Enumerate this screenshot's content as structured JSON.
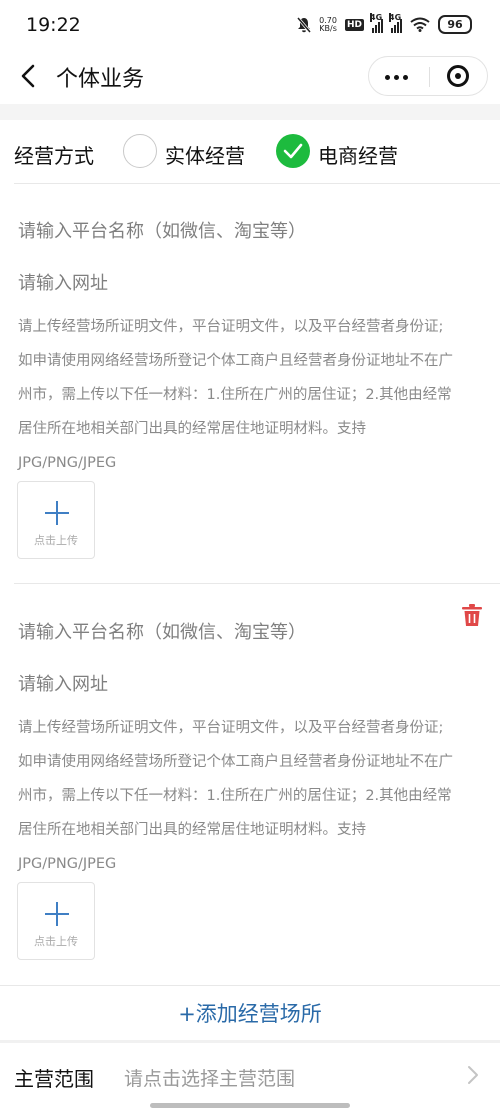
{
  "status_bar": {
    "time": "19:22",
    "net_speed_value": "0.70",
    "net_speed_unit": "KB/s",
    "hd_badge": "HD",
    "signal_1": "4G",
    "signal_2": "4G",
    "battery": "96",
    "icons": [
      "mute-bell-icon",
      "wifi-icon",
      "battery-icon"
    ]
  },
  "nav": {
    "title": "个体业务",
    "back_icon": "chevron-left-icon",
    "more_icon": "more-dots-icon",
    "close_icon": "miniprogram-close-icon"
  },
  "mode": {
    "label": "经营方式",
    "options": [
      {
        "label": "实体经营",
        "selected": false
      },
      {
        "label": "电商经营",
        "selected": true
      }
    ],
    "selected_color": "#1dbb3e"
  },
  "venues": [
    {
      "platform_placeholder": "请输入平台名称（如微信、淘宝等）",
      "url_placeholder": "请输入网址",
      "desc_lines": [
        "请上传经营场所证明文件，平台证明文件，以及平台经营者身份证;",
        "如申请使用网络经营场所登记个体工商户且经营者身份证地址不在广",
        "州市，需上传以下任一材料：1.住所在广州的居住证；2.其他由经常",
        "居住所在地相关部门出具的经常居住地证明材料。支持",
        "JPG/PNG/JPEG"
      ],
      "upload_label": "点击上传"
    },
    {
      "platform_placeholder": "请输入平台名称（如微信、淘宝等）",
      "url_placeholder": "请输入网址",
      "desc_lines": [
        "请上传经营场所证明文件，平台证明文件，以及平台经营者身份证;",
        "如申请使用网络经营场所登记个体工商户且经营者身份证地址不在广",
        "州市，需上传以下任一材料：1.住所在广州的居住证；2.其他由经常",
        "居住所在地相关部门出具的经常居住地证明材料。支持",
        "JPG/PNG/JPEG"
      ],
      "upload_label": "点击上传",
      "delete_icon": "trash-icon"
    }
  ],
  "add_button": "+添加经营场所",
  "scope": {
    "label": "主营范围",
    "placeholder": "请点击选择主营范围",
    "arrow_icon": "chevron-right-icon"
  },
  "colors": {
    "link": "#2a6aa8",
    "danger": "#e04848",
    "success": "#1dbb3e"
  }
}
